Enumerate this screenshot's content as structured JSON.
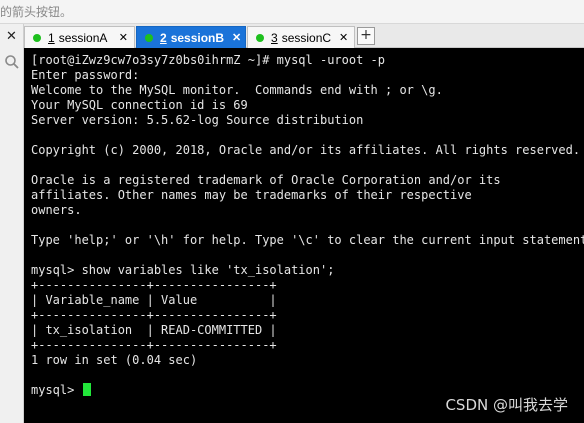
{
  "top_hint": "的箭头按钮。",
  "sidebar": {
    "close_glyph": "✕",
    "icon": "search-icon"
  },
  "tabs": [
    {
      "number": "1",
      "label": "sessionA",
      "active": false,
      "close": "✕"
    },
    {
      "number": "2",
      "label": "sessionB",
      "active": true,
      "close": "✕"
    },
    {
      "number": "3",
      "label": "sessionC",
      "active": false,
      "close": "✕"
    }
  ],
  "add_tab": "+",
  "terminal": {
    "lines": [
      "[root@iZwz9cw7o3sy7z0bs0ihrmZ ~]# mysql -uroot -p",
      "Enter password:",
      "Welcome to the MySQL monitor.  Commands end with ; or \\g.",
      "Your MySQL connection id is 69",
      "Server version: 5.5.62-log Source distribution",
      "",
      "Copyright (c) 2000, 2018, Oracle and/or its affiliates. All rights reserved.",
      "",
      "Oracle is a registered trademark of Oracle Corporation and/or its",
      "affiliates. Other names may be trademarks of their respective",
      "owners.",
      "",
      "Type 'help;' or '\\h' for help. Type '\\c' to clear the current input statement.",
      "",
      "mysql> show variables like 'tx_isolation';",
      "+---------------+----------------+",
      "| Variable_name | Value          |",
      "+---------------+----------------+",
      "| tx_isolation  | READ-COMMITTED |",
      "+---------------+----------------+",
      "1 row in set (0.04 sec)",
      ""
    ],
    "prompt": "mysql> "
  },
  "watermark": "CSDN @叫我去学"
}
